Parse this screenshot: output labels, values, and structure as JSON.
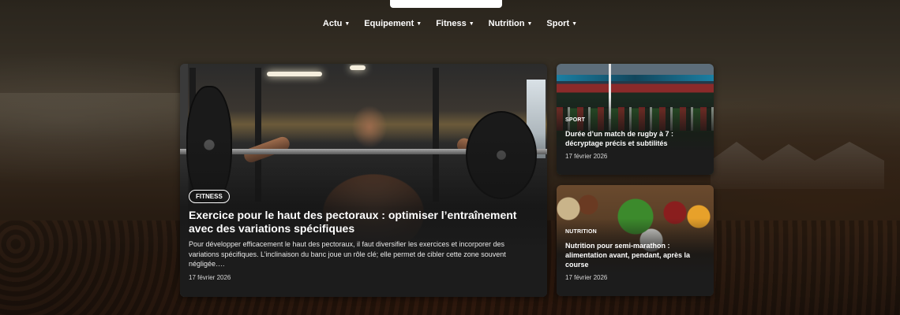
{
  "nav": {
    "items": [
      {
        "label": "Actu"
      },
      {
        "label": "Equipement"
      },
      {
        "label": "Fitness"
      },
      {
        "label": "Nutrition"
      },
      {
        "label": "Sport"
      }
    ]
  },
  "articles": {
    "main": {
      "category": "FITNESS",
      "title": "Exercice pour le haut des pectoraux : optimiser l’entraînement avec des variations spécifiques",
      "excerpt": "Pour développer efficacement le haut des pectoraux, il faut diversifier les exercices et incorporer des variations spécifiques. L’inclinaison du banc joue un rôle clé; elle permet de cibler cette zone souvent négligée….",
      "date": "17 février 2026"
    },
    "side1": {
      "category": "SPORT",
      "title": "Durée d’un match de rugby à 7 : décryptage précis et subtilités",
      "date": "17 février 2026"
    },
    "side2": {
      "category": "NUTRITION",
      "title": "Nutrition pour semi-marathon : alimentation avant, pendant, après la course",
      "date": "17 février 2026"
    }
  }
}
